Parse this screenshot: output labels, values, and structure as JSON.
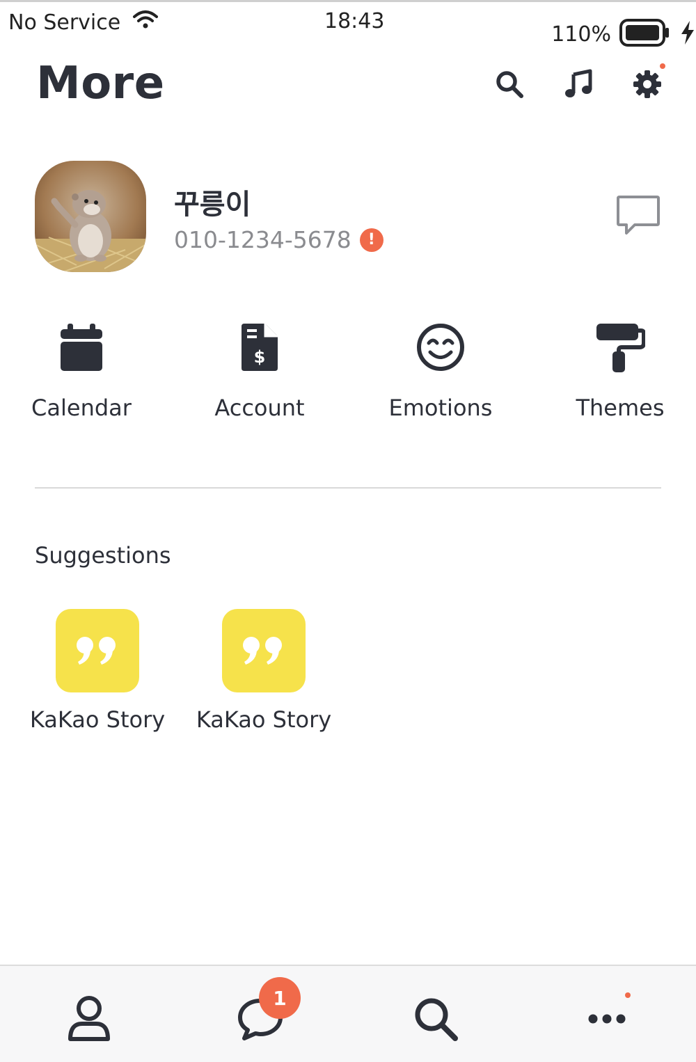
{
  "status_bar": {
    "carrier": "No Service",
    "time": "18:43",
    "battery_percent": "110%"
  },
  "header": {
    "title": "More",
    "icons": [
      "search-icon",
      "music-icon",
      "settings-icon"
    ],
    "settings_has_notification": true
  },
  "profile": {
    "name": "꾸릉이",
    "phone": "010-1234-5678",
    "alert_symbol": "!"
  },
  "quick_actions": [
    {
      "label": "Calendar",
      "icon": "calendar-icon"
    },
    {
      "label": "Account",
      "icon": "invoice-dollar-icon"
    },
    {
      "label": "Emotions",
      "icon": "smile-icon"
    },
    {
      "label": "Themes",
      "icon": "paint-roller-icon"
    }
  ],
  "suggestions": {
    "title": "Suggestions",
    "items": [
      {
        "label": "KaKao Story",
        "icon": "quote-icon"
      },
      {
        "label": "KaKao Story",
        "icon": "quote-icon"
      }
    ]
  },
  "bottom_nav": {
    "items": [
      {
        "name": "friends",
        "icon": "user-icon"
      },
      {
        "name": "chats",
        "icon": "chat-bubble-icon",
        "badge": "1"
      },
      {
        "name": "search",
        "icon": "search-icon"
      },
      {
        "name": "more",
        "icon": "ellipsis-icon",
        "has_notification": true
      }
    ]
  },
  "colors": {
    "accent_yellow": "#f6e24b",
    "badge_red": "#f06a4a",
    "icon_dark": "#2d3039",
    "muted_text": "#8a8b8f"
  }
}
